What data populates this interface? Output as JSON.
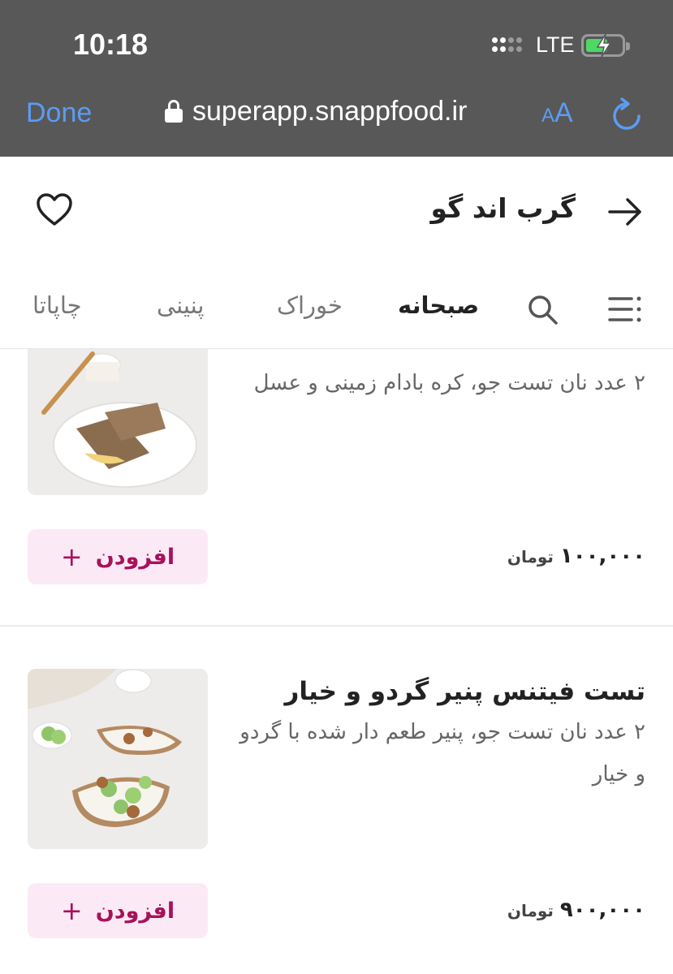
{
  "status_bar": {
    "time": "10:18",
    "network": "LTE"
  },
  "browser": {
    "done_label": "Done",
    "url": "superapp.snappfood.ir",
    "text_size_small": "A",
    "text_size_big": "A"
  },
  "header": {
    "title": "گرب اند گو"
  },
  "tabs": [
    {
      "label": "صبحانه",
      "active": true
    },
    {
      "label": "خوراک",
      "active": false
    },
    {
      "label": "پنینی",
      "active": false
    },
    {
      "label": "چاپاتا",
      "active": false
    }
  ],
  "products": [
    {
      "name": "",
      "description": "۲ عدد نان تست جو، کره بادام زمینی و عسل",
      "price": "۱۰۰,۰۰۰",
      "currency": "تومان",
      "add_label": "افزودن"
    },
    {
      "name": "تست فیتنس پنیر گردو و خیار",
      "description": "۲ عدد نان تست جو، پنیر طعم دار شده با گردو و خیار",
      "price": "۹۰۰,۰۰۰",
      "currency": "تومان",
      "add_label": "افزودن"
    }
  ],
  "colors": {
    "chrome_bg": "#585858",
    "link_blue": "#5b9cf5",
    "accent_pink": "#a8115c",
    "button_bg": "#fbeaf5"
  }
}
